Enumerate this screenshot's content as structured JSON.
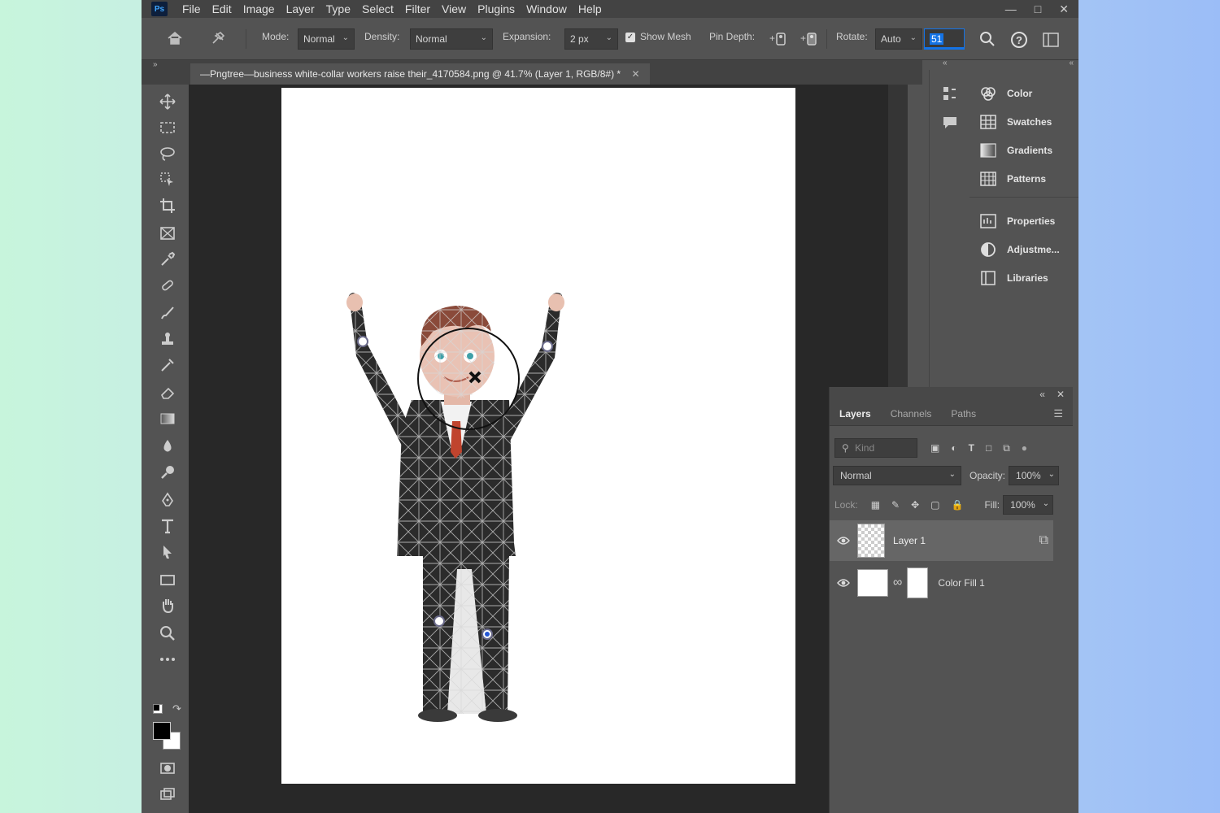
{
  "app": {
    "logo_text": "Ps",
    "menu": [
      "File",
      "Edit",
      "Image",
      "Layer",
      "Type",
      "Select",
      "Filter",
      "View",
      "Plugins",
      "Window",
      "Help"
    ]
  },
  "options_bar": {
    "mode_label": "Mode:",
    "mode_value": "Normal",
    "density_label": "Density:",
    "density_value": "Normal",
    "expansion_label": "Expansion:",
    "expansion_value": "2 px",
    "show_mesh_label": "Show Mesh",
    "show_mesh_checked": true,
    "pin_depth_label": "Pin Depth:",
    "rotate_label": "Rotate:",
    "rotate_value": "Auto",
    "angle_value": "51"
  },
  "document": {
    "tab_title": "—Pngtree—business white-collar workers raise their_4170584.png @ 41.7% (Layer 1, RGB/8#) *"
  },
  "right_panels": [
    "Color",
    "Swatches",
    "Gradients",
    "Patterns",
    "Properties",
    "Adjustme...",
    "Libraries"
  ],
  "layers_panel": {
    "tabs": [
      "Layers",
      "Channels",
      "Paths"
    ],
    "active_tab": "Layers",
    "search_placeholder": "Kind",
    "blend_mode": "Normal",
    "opacity_label": "Opacity:",
    "opacity_value": "100%",
    "lock_label": "Lock:",
    "fill_label": "Fill:",
    "fill_value": "100%",
    "layers": [
      {
        "name": "Layer 1",
        "visible": true,
        "selected": true
      },
      {
        "name": "Color Fill 1",
        "visible": true,
        "selected": false
      }
    ]
  },
  "colors": {
    "app_bg": "#535353",
    "canvas_bg": "#282828",
    "accent": "#1473e6"
  }
}
